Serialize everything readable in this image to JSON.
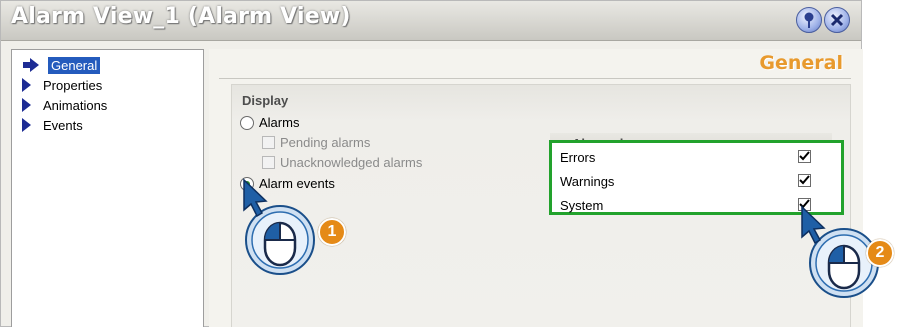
{
  "window": {
    "title": "Alarm View_1 (Alarm View)",
    "pin_icon": "pin-icon",
    "close_icon": "close-icon"
  },
  "nav": {
    "items": [
      {
        "label": "General",
        "active": true
      },
      {
        "label": "Properties",
        "active": false
      },
      {
        "label": "Animations",
        "active": false
      },
      {
        "label": "Events",
        "active": false
      }
    ]
  },
  "content": {
    "section_title": "General",
    "display_group": {
      "title": "Display",
      "radio_alarms": "Alarms",
      "pending_alarms": "Pending alarms",
      "unacknowledged_alarms": "Unacknowledged alarms",
      "radio_alarm_events": "Alarm events",
      "selected": "Alarm events"
    },
    "alarm_classes": {
      "title": "Alarm classes",
      "rows": [
        {
          "name": "Errors",
          "checked": true
        },
        {
          "name": "Warnings",
          "checked": true
        },
        {
          "name": "System",
          "checked": true
        }
      ]
    }
  },
  "callouts": {
    "step1": "1",
    "step2": "2"
  },
  "colors": {
    "highlight_border": "#22a22c",
    "step_badge": "#e58a17",
    "section_title": "#e89a2e",
    "nav_selected": "#245bbd"
  }
}
